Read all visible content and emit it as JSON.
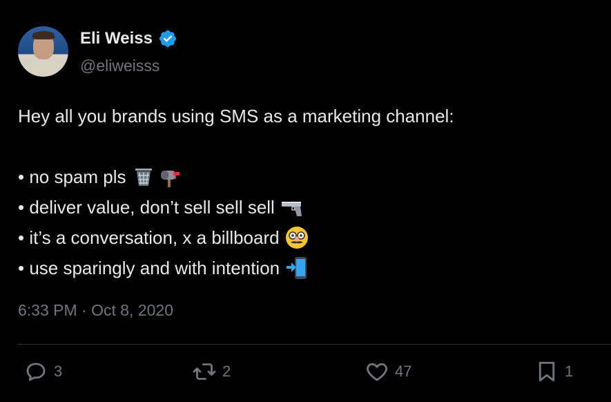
{
  "author": {
    "name": "Eli Weiss",
    "handle": "@eliweisss",
    "verified": true
  },
  "tweet": {
    "intro": "Hey all you brands using SMS as a marketing channel:",
    "bullets": [
      {
        "text": "• no spam pls",
        "icons": [
          "wastebasket-icon",
          "mailbox-icon"
        ]
      },
      {
        "text": "• deliver value, don’t sell sell sell",
        "icons": [
          "pistol-icon"
        ]
      },
      {
        "text": "• it’s a conversation, x a billboard",
        "icons": [
          "disguised-face-icon"
        ]
      },
      {
        "text": "• use sparingly and with intention",
        "icons": [
          "mobile-arrow-icon"
        ]
      }
    ],
    "timestamp": "6:33 PM · Oct 8, 2020"
  },
  "actions": {
    "reply_count": "3",
    "retweet_count": "2",
    "like_count": "47",
    "bookmark_count": "1"
  },
  "colors": {
    "background": "#000000",
    "text": "#e7e9ea",
    "secondary": "#71767b",
    "verified_badge": "#1d9bf0",
    "divider": "#2f3336"
  }
}
